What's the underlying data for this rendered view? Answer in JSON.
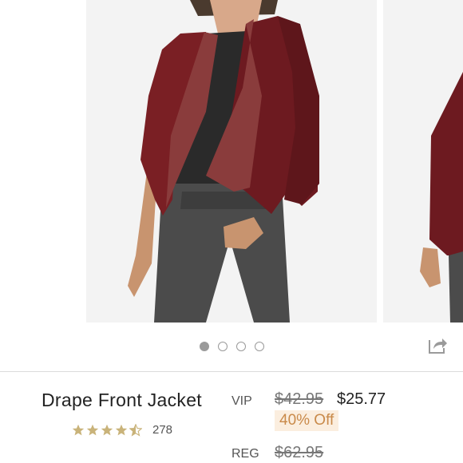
{
  "product": {
    "title": "Drape Front Jacket",
    "rating": {
      "stars": 4.5,
      "count": "278"
    },
    "vip": {
      "label": "VIP",
      "original_price": "$42.95",
      "sale_price": "$25.77",
      "discount": "40% Off"
    },
    "reg": {
      "label": "REG",
      "price": "$62.95"
    }
  },
  "carousel": {
    "total_slides": 4,
    "active_slide": 1
  },
  "colors": {
    "jacket": "#7a1f24",
    "star": "#c9b37a",
    "discount_bg": "#fbeedf",
    "discount_text": "#c98a4a",
    "dot": "#9a9a9a"
  },
  "icons": [
    "share-icon",
    "star-icon"
  ]
}
